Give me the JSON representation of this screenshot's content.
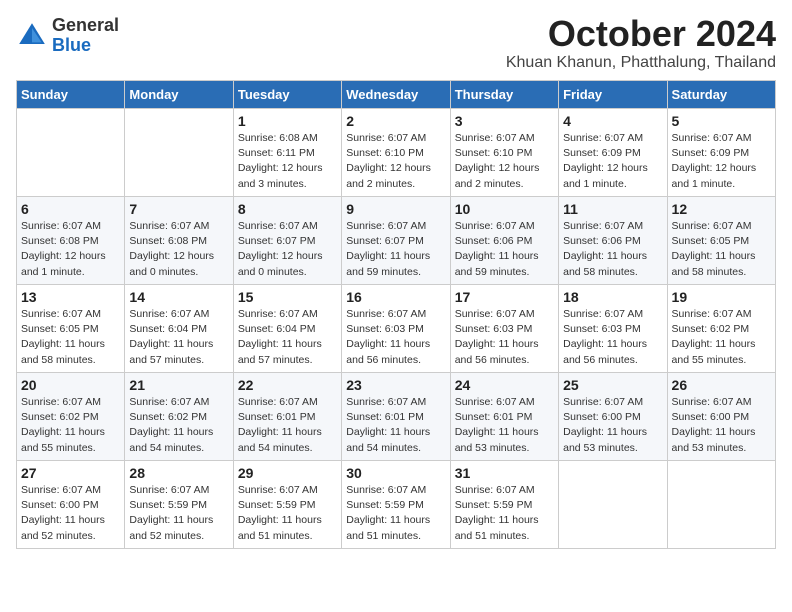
{
  "logo": {
    "general": "General",
    "blue": "Blue"
  },
  "title": "October 2024",
  "location": "Khuan Khanun, Phatthalung, Thailand",
  "headers": [
    "Sunday",
    "Monday",
    "Tuesday",
    "Wednesday",
    "Thursday",
    "Friday",
    "Saturday"
  ],
  "weeks": [
    [
      {
        "day": "",
        "detail": ""
      },
      {
        "day": "",
        "detail": ""
      },
      {
        "day": "1",
        "detail": "Sunrise: 6:08 AM\nSunset: 6:11 PM\nDaylight: 12 hours\nand 3 minutes."
      },
      {
        "day": "2",
        "detail": "Sunrise: 6:07 AM\nSunset: 6:10 PM\nDaylight: 12 hours\nand 2 minutes."
      },
      {
        "day": "3",
        "detail": "Sunrise: 6:07 AM\nSunset: 6:10 PM\nDaylight: 12 hours\nand 2 minutes."
      },
      {
        "day": "4",
        "detail": "Sunrise: 6:07 AM\nSunset: 6:09 PM\nDaylight: 12 hours\nand 1 minute."
      },
      {
        "day": "5",
        "detail": "Sunrise: 6:07 AM\nSunset: 6:09 PM\nDaylight: 12 hours\nand 1 minute."
      }
    ],
    [
      {
        "day": "6",
        "detail": "Sunrise: 6:07 AM\nSunset: 6:08 PM\nDaylight: 12 hours\nand 1 minute."
      },
      {
        "day": "7",
        "detail": "Sunrise: 6:07 AM\nSunset: 6:08 PM\nDaylight: 12 hours\nand 0 minutes."
      },
      {
        "day": "8",
        "detail": "Sunrise: 6:07 AM\nSunset: 6:07 PM\nDaylight: 12 hours\nand 0 minutes."
      },
      {
        "day": "9",
        "detail": "Sunrise: 6:07 AM\nSunset: 6:07 PM\nDaylight: 11 hours\nand 59 minutes."
      },
      {
        "day": "10",
        "detail": "Sunrise: 6:07 AM\nSunset: 6:06 PM\nDaylight: 11 hours\nand 59 minutes."
      },
      {
        "day": "11",
        "detail": "Sunrise: 6:07 AM\nSunset: 6:06 PM\nDaylight: 11 hours\nand 58 minutes."
      },
      {
        "day": "12",
        "detail": "Sunrise: 6:07 AM\nSunset: 6:05 PM\nDaylight: 11 hours\nand 58 minutes."
      }
    ],
    [
      {
        "day": "13",
        "detail": "Sunrise: 6:07 AM\nSunset: 6:05 PM\nDaylight: 11 hours\nand 58 minutes."
      },
      {
        "day": "14",
        "detail": "Sunrise: 6:07 AM\nSunset: 6:04 PM\nDaylight: 11 hours\nand 57 minutes."
      },
      {
        "day": "15",
        "detail": "Sunrise: 6:07 AM\nSunset: 6:04 PM\nDaylight: 11 hours\nand 57 minutes."
      },
      {
        "day": "16",
        "detail": "Sunrise: 6:07 AM\nSunset: 6:03 PM\nDaylight: 11 hours\nand 56 minutes."
      },
      {
        "day": "17",
        "detail": "Sunrise: 6:07 AM\nSunset: 6:03 PM\nDaylight: 11 hours\nand 56 minutes."
      },
      {
        "day": "18",
        "detail": "Sunrise: 6:07 AM\nSunset: 6:03 PM\nDaylight: 11 hours\nand 56 minutes."
      },
      {
        "day": "19",
        "detail": "Sunrise: 6:07 AM\nSunset: 6:02 PM\nDaylight: 11 hours\nand 55 minutes."
      }
    ],
    [
      {
        "day": "20",
        "detail": "Sunrise: 6:07 AM\nSunset: 6:02 PM\nDaylight: 11 hours\nand 55 minutes."
      },
      {
        "day": "21",
        "detail": "Sunrise: 6:07 AM\nSunset: 6:02 PM\nDaylight: 11 hours\nand 54 minutes."
      },
      {
        "day": "22",
        "detail": "Sunrise: 6:07 AM\nSunset: 6:01 PM\nDaylight: 11 hours\nand 54 minutes."
      },
      {
        "day": "23",
        "detail": "Sunrise: 6:07 AM\nSunset: 6:01 PM\nDaylight: 11 hours\nand 54 minutes."
      },
      {
        "day": "24",
        "detail": "Sunrise: 6:07 AM\nSunset: 6:01 PM\nDaylight: 11 hours\nand 53 minutes."
      },
      {
        "day": "25",
        "detail": "Sunrise: 6:07 AM\nSunset: 6:00 PM\nDaylight: 11 hours\nand 53 minutes."
      },
      {
        "day": "26",
        "detail": "Sunrise: 6:07 AM\nSunset: 6:00 PM\nDaylight: 11 hours\nand 53 minutes."
      }
    ],
    [
      {
        "day": "27",
        "detail": "Sunrise: 6:07 AM\nSunset: 6:00 PM\nDaylight: 11 hours\nand 52 minutes."
      },
      {
        "day": "28",
        "detail": "Sunrise: 6:07 AM\nSunset: 5:59 PM\nDaylight: 11 hours\nand 52 minutes."
      },
      {
        "day": "29",
        "detail": "Sunrise: 6:07 AM\nSunset: 5:59 PM\nDaylight: 11 hours\nand 51 minutes."
      },
      {
        "day": "30",
        "detail": "Sunrise: 6:07 AM\nSunset: 5:59 PM\nDaylight: 11 hours\nand 51 minutes."
      },
      {
        "day": "31",
        "detail": "Sunrise: 6:07 AM\nSunset: 5:59 PM\nDaylight: 11 hours\nand 51 minutes."
      },
      {
        "day": "",
        "detail": ""
      },
      {
        "day": "",
        "detail": ""
      }
    ]
  ]
}
